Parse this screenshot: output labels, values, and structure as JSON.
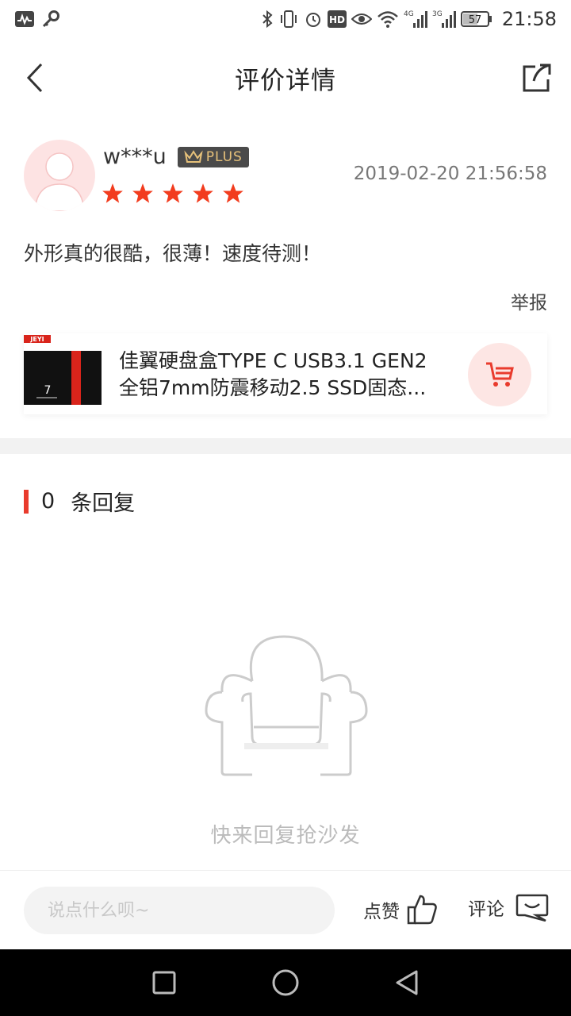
{
  "status_bar": {
    "time": "21:58",
    "battery": "57",
    "net_4g": "4G",
    "net_3g": "3G",
    "hd": "HD"
  },
  "nav": {
    "title": "评价详情"
  },
  "review": {
    "username": "w***u",
    "badge": "PLUS",
    "rating": 5,
    "timestamp": "2019-02-20 21:56:58",
    "content": "外形真的很酷，很薄！速度待测！",
    "report_label": "举报"
  },
  "product": {
    "brand_tag": "JEYI",
    "name_line1": "佳翼硬盘盒TYPE C USB3.1 GEN2",
    "name_line2": "全铝7mm防震移动2.5 SSD固态..."
  },
  "replies": {
    "count": "0",
    "label": "条回复",
    "empty_text": "快来回复抢沙发"
  },
  "bottom_bar": {
    "input_placeholder": "说点什么呗~",
    "like_label": "点赞",
    "comment_label": "评论"
  },
  "colors": {
    "accent": "#e93b2d",
    "star": "#f23c1e",
    "avatar_bg": "#fde3e3"
  }
}
